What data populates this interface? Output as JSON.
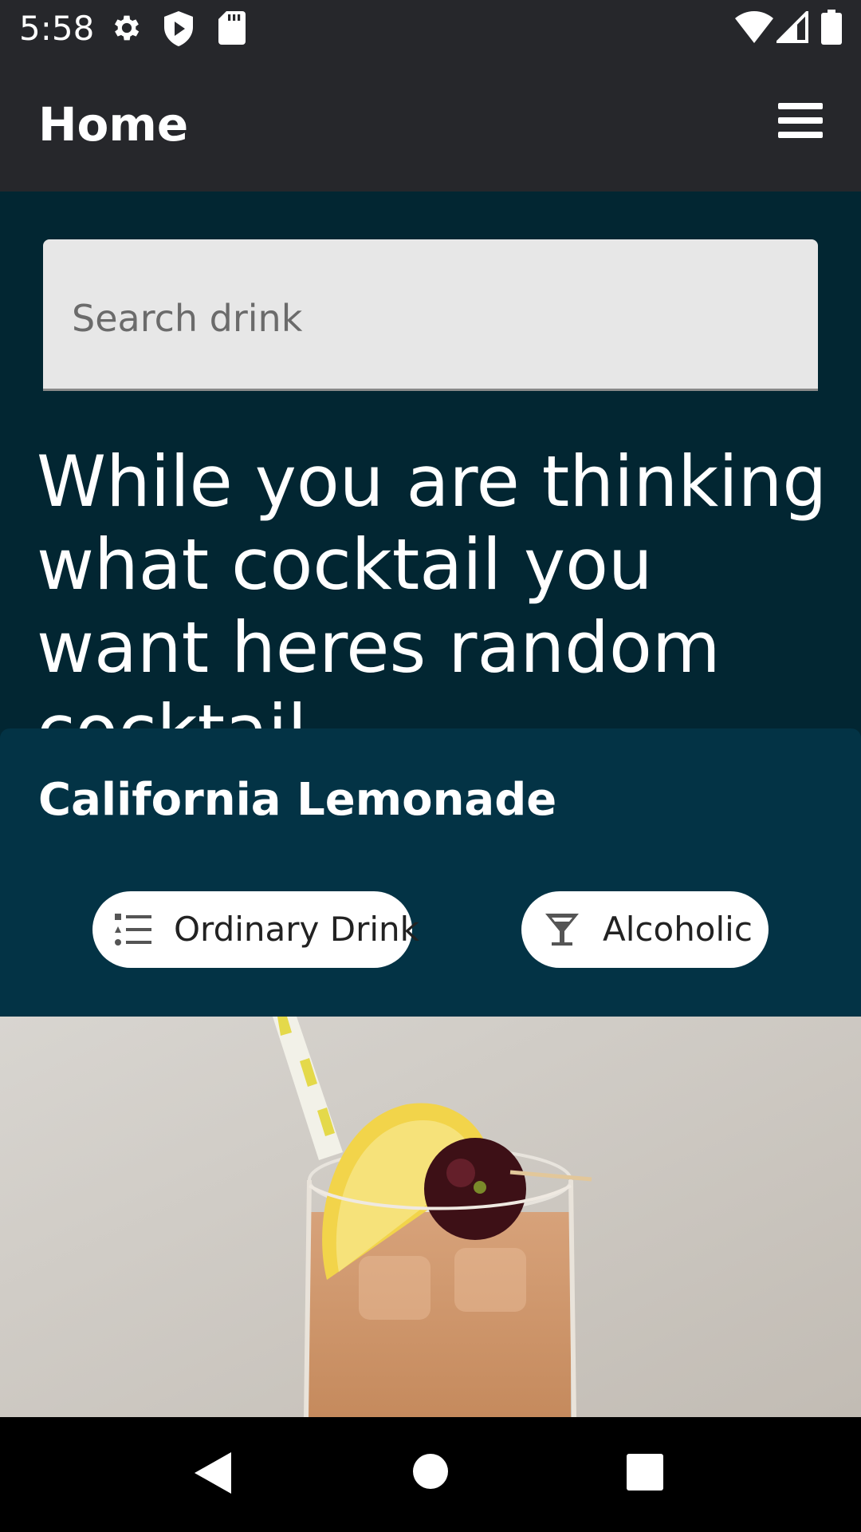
{
  "status_bar": {
    "time": "5:58",
    "left_icons": [
      "settings-icon",
      "shield-play-icon",
      "sd-card-icon"
    ],
    "right_icons": [
      "wifi-icon",
      "cellular-signal-icon",
      "battery-icon"
    ]
  },
  "app_bar": {
    "title": "Home",
    "menu_icon": "hamburger-menu-icon"
  },
  "search": {
    "placeholder": "Search drink",
    "value": ""
  },
  "intro": {
    "text": "While you are thinking what cocktail you want heres random cocktail"
  },
  "card": {
    "title": "California Lemonade",
    "chips": [
      {
        "label": "Ordinary Drink",
        "icon": "list-icon"
      },
      {
        "label": "Alcoholic",
        "icon": "cocktail-glass-icon"
      }
    ],
    "image_alt": "California Lemonade cocktail with lemon slice, cherry and straw"
  },
  "nav_bar": {
    "icons": [
      "back-icon",
      "home-icon",
      "recents-icon"
    ]
  },
  "colors": {
    "bars": "#26272b",
    "background": "#022632",
    "card": "#033345",
    "search_field": "#e7e7e7",
    "chip": "#ffffff"
  }
}
